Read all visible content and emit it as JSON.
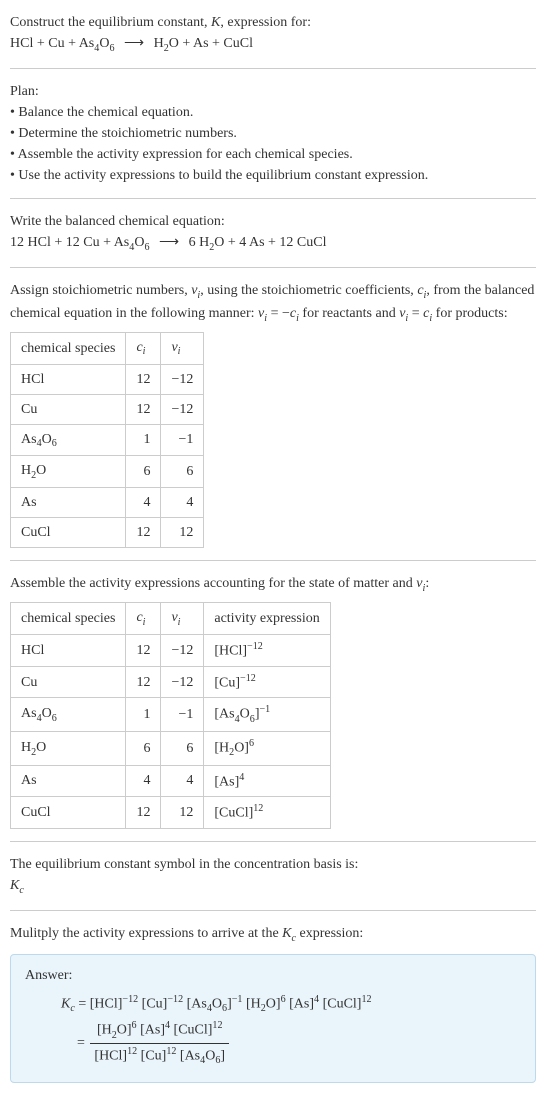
{
  "prompt": {
    "line1": "Construct the equilibrium constant, ",
    "K": "K",
    "line1b": ", expression for:",
    "eq_lhs1": "HCl + Cu + As",
    "eq_lhs_sub1": "4",
    "eq_lhs2": "O",
    "eq_lhs_sub2": "6",
    "arrow": "⟶",
    "eq_rhs1": "H",
    "eq_rhs_sub1": "2",
    "eq_rhs2": "O + As + CuCl"
  },
  "plan": {
    "title": "Plan:",
    "items": [
      "Balance the chemical equation.",
      "Determine the stoichiometric numbers.",
      "Assemble the activity expression for each chemical species.",
      "Use the activity expressions to build the equilibrium constant expression."
    ]
  },
  "bal": {
    "title": "Write the balanced chemical equation:",
    "text_a": "12 HCl + 12 Cu + As",
    "s1": "4",
    "text_b": "O",
    "s2": "6",
    "arrow": "⟶",
    "text_c": "6 H",
    "s3": "2",
    "text_d": "O + 4 As + 12 CuCl"
  },
  "assign": {
    "line1a": "Assign stoichiometric numbers, ",
    "nu": "ν",
    "i": "i",
    "line1b": ", using the stoichiometric coefficients, ",
    "c": "c",
    "line1c": ", from the balanced chemical equation in the following manner: ",
    "eq1": " = −",
    "line1d": " for reactants and ",
    "eq2": " = ",
    "line1e": " for products:"
  },
  "table1": {
    "headers": {
      "h1": "chemical species",
      "h2": "c",
      "h2i": "i",
      "h3": "ν",
      "h3i": "i"
    },
    "rows": [
      {
        "sp_a": "HCl",
        "sp_b": "",
        "sp_c": "",
        "c": "12",
        "nu": "−12"
      },
      {
        "sp_a": "Cu",
        "sp_b": "",
        "sp_c": "",
        "c": "12",
        "nu": "−12"
      },
      {
        "sp_a": "As",
        "sub1": "4",
        "sp_b": "O",
        "sub2": "6",
        "c": "1",
        "nu": "−1"
      },
      {
        "sp_a": "H",
        "sub1": "2",
        "sp_b": "O",
        "sub2": "",
        "c": "6",
        "nu": "6"
      },
      {
        "sp_a": "As",
        "sp_b": "",
        "sp_c": "",
        "c": "4",
        "nu": "4"
      },
      {
        "sp_a": "CuCl",
        "sp_b": "",
        "sp_c": "",
        "c": "12",
        "nu": "12"
      }
    ]
  },
  "assemble": {
    "text_a": "Assemble the activity expressions accounting for the state of matter and ",
    "nu": "ν",
    "i": "i",
    "text_b": ":"
  },
  "table2": {
    "headers": {
      "h1": "chemical species",
      "h2": "c",
      "h2i": "i",
      "h3": "ν",
      "h3i": "i",
      "h4": "activity expression"
    },
    "rows": [
      {
        "sp_a": "HCl",
        "c": "12",
        "nu": "−12",
        "ae_b": "[HCl]",
        "ae_e": "−12"
      },
      {
        "sp_a": "Cu",
        "c": "12",
        "nu": "−12",
        "ae_b": "[Cu]",
        "ae_e": "−12"
      },
      {
        "sp_a": "As",
        "sub1": "4",
        "sp_b": "O",
        "sub2": "6",
        "c": "1",
        "nu": "−1",
        "ae_b": "[As",
        "ae_s1": "4",
        "ae_m": "O",
        "ae_s2": "6",
        "ae_b2": "]",
        "ae_e": "−1"
      },
      {
        "sp_a": "H",
        "sub1": "2",
        "sp_b": "O",
        "c": "6",
        "nu": "6",
        "ae_b": "[H",
        "ae_s1": "2",
        "ae_m": "O]",
        "ae_e": "6"
      },
      {
        "sp_a": "As",
        "c": "4",
        "nu": "4",
        "ae_b": "[As]",
        "ae_e": "4"
      },
      {
        "sp_a": "CuCl",
        "c": "12",
        "nu": "12",
        "ae_b": "[CuCl]",
        "ae_e": "12"
      }
    ]
  },
  "eqsym": {
    "line": "The equilibrium constant symbol in the concentration basis is:",
    "K": "K",
    "c": "c"
  },
  "mult": {
    "line_a": "Mulitply the activity expressions to arrive at the ",
    "K": "K",
    "c": "c",
    "line_b": " expression:"
  },
  "answer": {
    "label": "Answer:",
    "Kc_K": "K",
    "Kc_c": "c",
    "eq": " = ",
    "p1": "[HCl]",
    "e1": "−12",
    "p2": " [Cu]",
    "e2": "−12",
    "p3": " [As",
    "p3s1": "4",
    "p3m": "O",
    "p3s2": "6",
    "p3b": "]",
    "e3": "−1",
    "p4": " [H",
    "p4s1": "2",
    "p4m": "O]",
    "e4": "6",
    "p5": " [As]",
    "e5": "4",
    "p6": " [CuCl]",
    "e6": "12",
    "num1": "[H",
    "num1s": "2",
    "num1b": "O]",
    "ne1": "6",
    "num2": " [As]",
    "ne2": "4",
    "num3": " [CuCl]",
    "ne3": "12",
    "den1": "[HCl]",
    "de1": "12",
    "den2": " [Cu]",
    "de2": "12",
    "den3": " [As",
    "den3s1": "4",
    "den3m": "O",
    "den3s2": "6",
    "den3b": "]"
  }
}
